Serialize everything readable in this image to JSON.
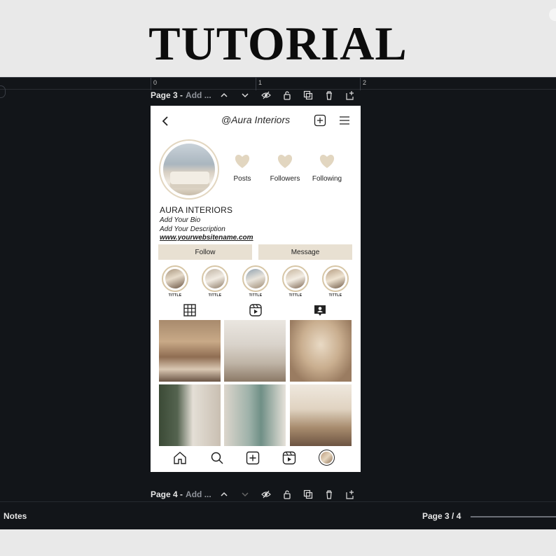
{
  "banner": {
    "title": "TUTORIAL"
  },
  "ruler": {
    "marks": [
      "0",
      "1",
      "2"
    ]
  },
  "page3": {
    "name": "Page 3 -",
    "add": "Add ..."
  },
  "page4": {
    "name": "Page 4 -",
    "add": "Add ..."
  },
  "profile": {
    "handle": "@Aura Interiors",
    "stats": [
      "Posts",
      "Followers",
      "Following"
    ],
    "name": "AURA INTERIORS",
    "bio": "Add Your Bio",
    "description": "Add Your Description",
    "website": "www.yourwebsitename.com",
    "follow_label": "Follow",
    "message_label": "Message",
    "highlight_title": "TITTLE"
  },
  "colors": {
    "editor_bg": "#121519",
    "beige": "#e8e0d2",
    "heart": "#e2d6c0"
  },
  "footer": {
    "notes": "Notes",
    "page_count": "Page 3 / 4",
    "zoom_fraction": 1.0
  }
}
